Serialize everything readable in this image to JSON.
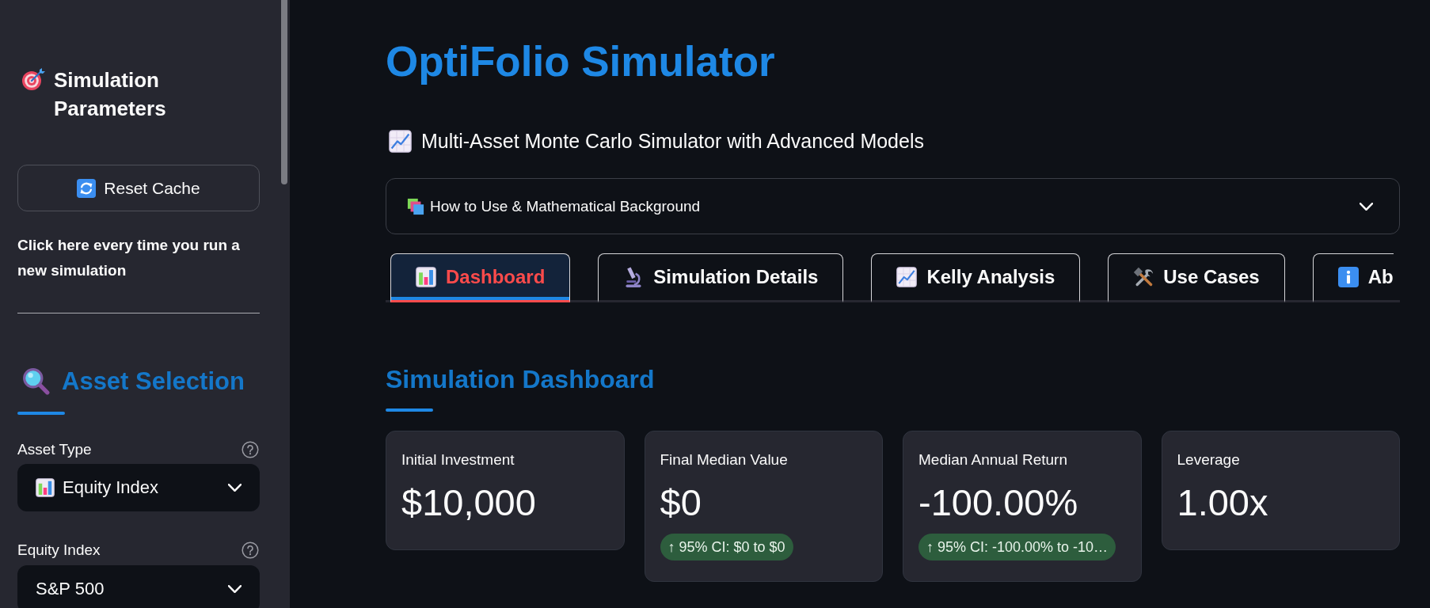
{
  "sidebar": {
    "title": "Simulation Parameters",
    "reset_button": "Reset Cache",
    "note": "Click here every time you run a new simulation",
    "section_title": "Asset Selection",
    "fields": [
      {
        "kind": "icon",
        "label": "Asset Type",
        "value": "Equity Index",
        "help": true
      },
      {
        "kind": "plain",
        "label": "Equity Index",
        "value": "S&P 500",
        "help": true
      }
    ]
  },
  "main": {
    "title": "OptiFolio Simulator",
    "subtitle": "Multi-Asset Monte Carlo Simulator with Advanced Models",
    "expander": {
      "label": "How to Use & Mathematical Background",
      "expanded": false
    },
    "tabs": [
      {
        "label": "Dashboard",
        "selected": true
      },
      {
        "label": "Simulation Details",
        "selected": false
      },
      {
        "label": "Kelly Analysis",
        "selected": false
      },
      {
        "label": "Use Cases",
        "selected": false
      },
      {
        "label": "Ab",
        "selected": false
      }
    ],
    "section_title": "Simulation Dashboard",
    "metrics": [
      {
        "label": "Initial Investment",
        "value": "$10,000"
      },
      {
        "label": "Final Median Value",
        "value": "$0",
        "delta": "↑ 95% CI: $0 to $0"
      },
      {
        "label": "Median Annual Return",
        "value": "-100.00%",
        "delta": "↑ 95% CI: -100.00% to -10…"
      },
      {
        "label": "Leverage",
        "value": "1.00x"
      }
    ]
  }
}
